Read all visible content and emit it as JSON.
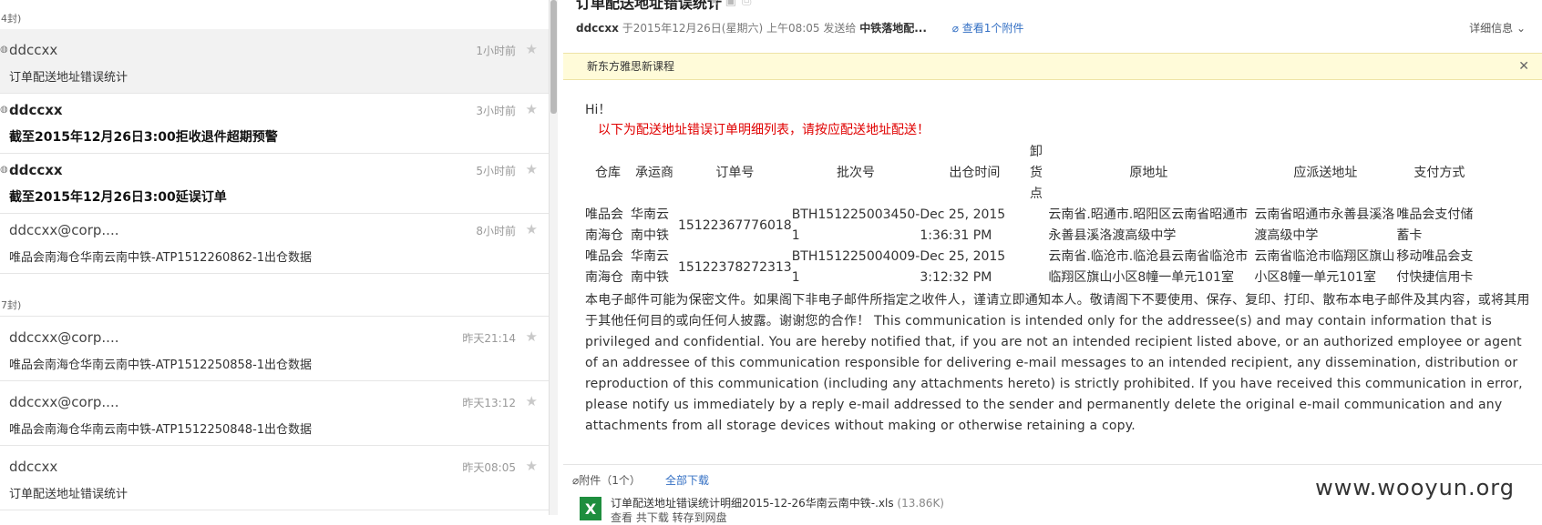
{
  "list": {
    "groups": [
      "4封)",
      "7封)"
    ],
    "mails": [
      {
        "sender": "ddccxx",
        "time": "1小时前",
        "subject": "订单配送地址错误统计",
        "unread": false,
        "selected": true
      },
      {
        "sender": "ddccxx",
        "time": "3小时前",
        "subject": "截至2015年12月26日3:00拒收退件超期预警",
        "unread": true,
        "selected": false
      },
      {
        "sender": "ddccxx",
        "time": "5小时前",
        "subject": "截至2015年12月26日3:00延误订单",
        "unread": true,
        "selected": false
      },
      {
        "sender": "ddccxx@corp....",
        "time": "8小时前",
        "subject": "唯品会南海仓华南云南中铁-ATP1512260862-1出仓数据",
        "unread": false,
        "selected": false
      },
      {
        "sender": "ddccxx@corp....",
        "time": "昨天21:14",
        "subject": "唯品会南海仓华南云南中铁-ATP1512250858-1出仓数据",
        "unread": false,
        "selected": false
      },
      {
        "sender": "ddccxx@corp....",
        "time": "昨天13:12",
        "subject": "唯品会南海仓华南云南中铁-ATP1512250848-1出仓数据",
        "unread": false,
        "selected": false
      },
      {
        "sender": "ddccxx",
        "time": "昨天08:05",
        "subject": "订单配送地址错误统计",
        "unread": false,
        "selected": false
      }
    ]
  },
  "mail": {
    "title": "订单配送地址错误统计",
    "sender": "ddccxx",
    "date": "于2015年12月26日(星期六) 上午08:05 发送给",
    "recipient": "中铁落地配...",
    "attach_link": "查看1个附件",
    "details": "详细信息",
    "notice": "新东方雅思新课程",
    "greeting": "Hi！",
    "intro": "以下为配送地址错误订单明细列表，请按应配送地址配送！",
    "table": {
      "headers": [
        "仓库",
        "承运商",
        "订单号",
        "批次号",
        "出仓时间",
        "卸货点",
        "原地址",
        "应派送地址",
        "支付方式"
      ],
      "rows": [
        [
          "唯品会南海仓",
          "华南云南中铁",
          "15122367776018",
          "BTH151225003450-1",
          "Dec 25, 2015 1:36:31 PM",
          "",
          "云南省.昭通市.昭阳区云南省昭通市永善县溪洛渡高级中学",
          "云南省昭通市永善县溪洛渡高级中学",
          "唯品会支付储蓄卡"
        ],
        [
          "唯品会南海仓",
          "华南云南中铁",
          "15122378272313",
          "BTH151225004009-1",
          "Dec 25, 2015 3:12:32 PM",
          "",
          "云南省.临沧市.临沧县云南省临沧市临翔区旗山小区8幢一单元101室",
          "云南省临沧市临翔区旗山小区8幢一单元101室",
          "移动唯品会支付快捷信用卡"
        ]
      ]
    },
    "disclaimer": "本电子邮件可能为保密文件。如果阁下非电子邮件所指定之收件人，谨请立即通知本人。敬请阁下不要使用、保存、复印、打印、散布本电子邮件及其内容，或将其用于其他任何目的或向任何人披露。谢谢您的合作！ This communication is intended only for the addressee(s) and may contain information that is privileged and confidential. You are hereby notified that, if you are not an intended recipient listed above, or an authorized employee or agent of an addressee of this communication responsible for delivering e-mail messages to an intended recipient, any dissemination, distribution or reproduction of this communication (including any attachments hereto) is strictly prohibited. If you have received this communication in error, please notify us immediately by a reply e-mail addressed to the sender and permanently delete the original e-mail communication and any attachments from all storage devices without making or otherwise retaining a copy.",
    "attachments_label": "附件（1个）",
    "download_all": "全部下载",
    "file_name": "订单配送地址错误统计明细2015-12-26华南云南中铁-.xls",
    "file_size": "(13.86K)",
    "file_actions": "查看 共下载 转存到网盘",
    "xls_icon": "X"
  },
  "watermark": "www.wooyun.org"
}
